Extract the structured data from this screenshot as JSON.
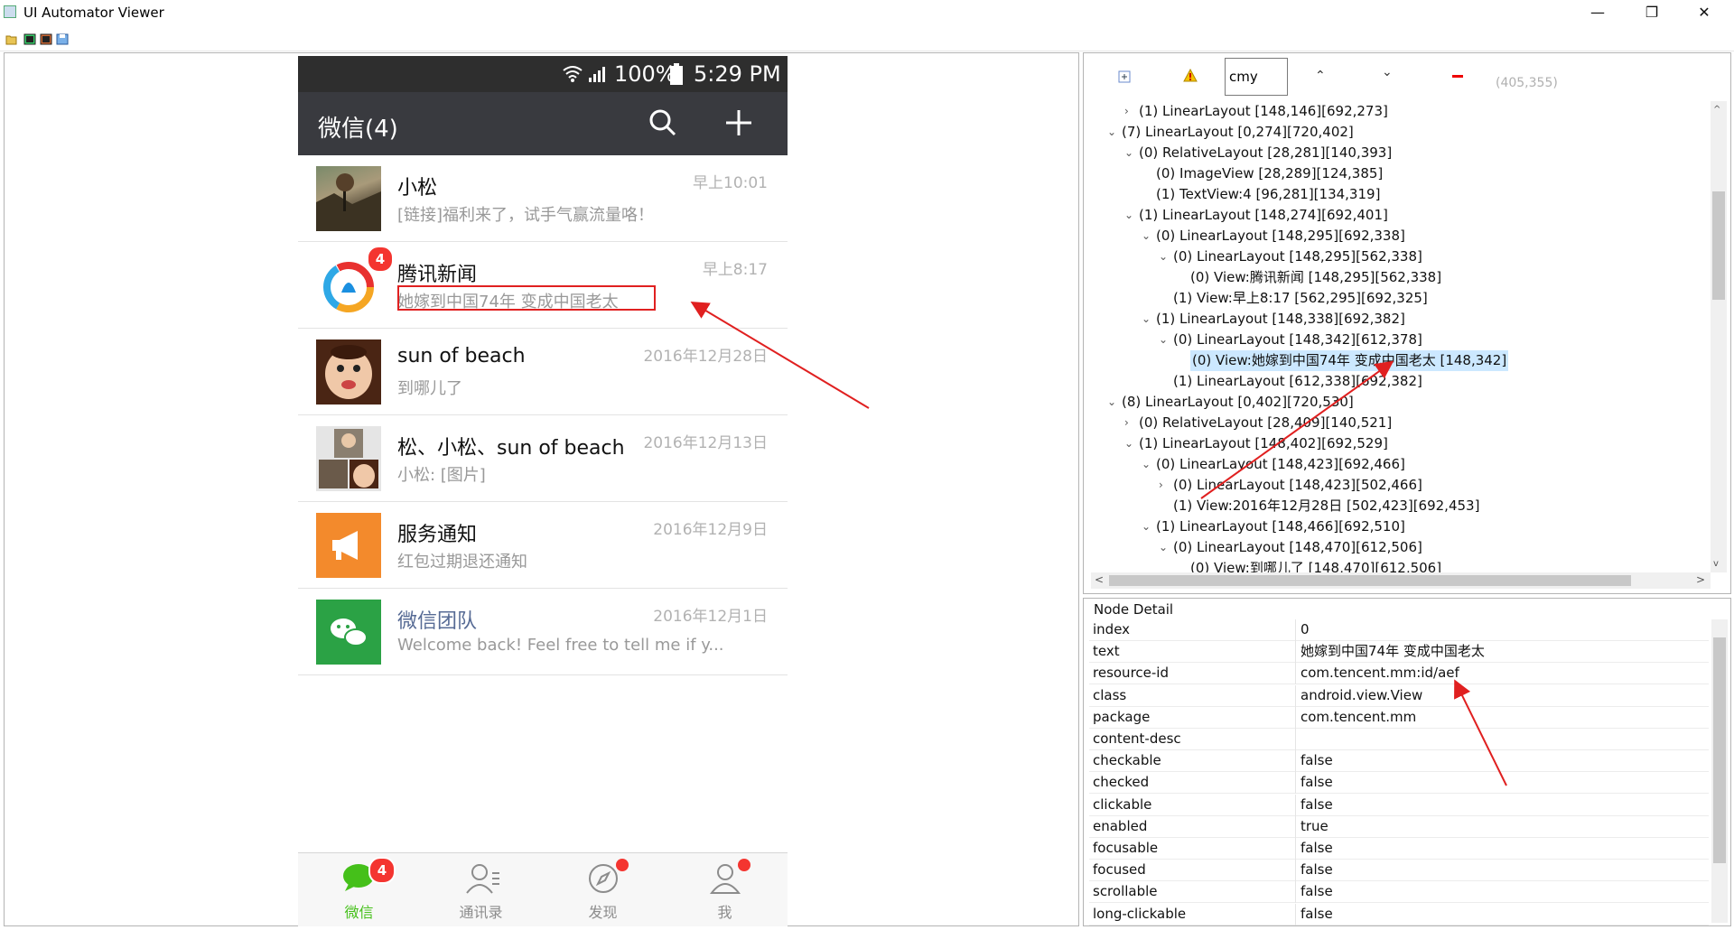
{
  "window": {
    "title": "UI Automator Viewer",
    "minimize_glyph": "—",
    "restore_glyph": "❐",
    "close_glyph": "✕"
  },
  "toolbar": {
    "icons": [
      "open-folder-icon",
      "device-screenshot-icon",
      "device-screenshot-compressed-icon",
      "save-icon"
    ]
  },
  "phone": {
    "status": {
      "battery_pct": "100%",
      "clock": "5:29 PM"
    },
    "appbar": {
      "title": "微信(4)"
    },
    "chats": [
      {
        "name": "小松",
        "time": "早上10:01",
        "message": "[链接]福利来了，试手气赢流量咯！",
        "avatar": "photo-avatar",
        "badge": ""
      },
      {
        "name": "腾讯新闻",
        "time": "早上8:17",
        "message": "她嫁到中国74年 变成中国老太",
        "avatar": "tencent-news-avatar",
        "badge": "4"
      },
      {
        "name": "sun of beach",
        "time": "2016年12月28日",
        "message": "到哪儿了",
        "avatar": "cartoon-avatar",
        "badge": ""
      },
      {
        "name": "松、小松、sun of beach",
        "time": "2016年12月13日",
        "message": "小松: [图片]",
        "avatar": "group-avatar",
        "badge": ""
      },
      {
        "name": "服务通知",
        "time": "2016年12月9日",
        "message": "红包过期退还通知",
        "avatar": "service-notice-avatar",
        "badge": ""
      },
      {
        "name": "微信团队",
        "time": "2016年12月1日",
        "message": "Welcome back! Feel free to tell me if y...",
        "avatar": "wechat-team-avatar",
        "badge": ""
      }
    ],
    "tabs": [
      {
        "label": "微信",
        "badge": "4",
        "active": true
      },
      {
        "label": "通讯录",
        "badge": "",
        "active": false
      },
      {
        "label": "发现",
        "badge": "dot",
        "active": false
      },
      {
        "label": "我",
        "badge": "dot",
        "active": false
      }
    ],
    "colors": {
      "statusbar": "#2e2e2e",
      "appbar": "#393a3f",
      "accent_green": "#45c01a",
      "badge_red": "#f43530",
      "team_blue": "#576b95"
    }
  },
  "tree": {
    "search_value": "cmy",
    "coords": "(405,355)",
    "nodes": [
      {
        "depth": 1,
        "toggle": ">",
        "text": "(1) LinearLayout [148,146][692,273]"
      },
      {
        "depth": 0,
        "toggle": "v",
        "text": "(7) LinearLayout [0,274][720,402]"
      },
      {
        "depth": 1,
        "toggle": "v",
        "text": "(0) RelativeLayout [28,281][140,393]"
      },
      {
        "depth": 2,
        "toggle": "",
        "text": "(0) ImageView [28,289][124,385]"
      },
      {
        "depth": 2,
        "toggle": "",
        "text": "(1) TextView:4 [96,281][134,319]"
      },
      {
        "depth": 1,
        "toggle": "v",
        "text": "(1) LinearLayout [148,274][692,401]"
      },
      {
        "depth": 2,
        "toggle": "v",
        "text": "(0) LinearLayout [148,295][692,338]"
      },
      {
        "depth": 3,
        "toggle": "v",
        "text": "(0) LinearLayout [148,295][562,338]"
      },
      {
        "depth": 4,
        "toggle": "",
        "text": "(0) View:腾讯新闻 [148,295][562,338]"
      },
      {
        "depth": 3,
        "toggle": "",
        "text": "(1) View:早上8:17 [562,295][692,325]"
      },
      {
        "depth": 2,
        "toggle": "v",
        "text": "(1) LinearLayout [148,338][692,382]"
      },
      {
        "depth": 3,
        "toggle": "v",
        "text": "(0) LinearLayout [148,342][612,378]"
      },
      {
        "depth": 4,
        "toggle": "",
        "text": "(0) View:她嫁到中国74年 变成中国老太 [148,342]",
        "selected": true
      },
      {
        "depth": 3,
        "toggle": "",
        "text": "(1) LinearLayout [612,338][692,382]"
      },
      {
        "depth": 0,
        "toggle": "v",
        "text": "(8) LinearLayout [0,402][720,530]"
      },
      {
        "depth": 1,
        "toggle": ">",
        "text": "(0) RelativeLayout [28,409][140,521]"
      },
      {
        "depth": 1,
        "toggle": "v",
        "text": "(1) LinearLayout [148,402][692,529]"
      },
      {
        "depth": 2,
        "toggle": "v",
        "text": "(0) LinearLayout [148,423][692,466]"
      },
      {
        "depth": 3,
        "toggle": ">",
        "text": "(0) LinearLayout [148,423][502,466]"
      },
      {
        "depth": 3,
        "toggle": "",
        "text": "(1) View:2016年12月28日 [502,423][692,453]"
      },
      {
        "depth": 2,
        "toggle": "v",
        "text": "(1) LinearLayout [148,466][692,510]"
      },
      {
        "depth": 3,
        "toggle": "v",
        "text": "(0) LinearLayout [148,470][612,506]"
      },
      {
        "depth": 4,
        "toggle": "",
        "text": "(0) View:到哪儿了 [148,470][612,506]"
      }
    ]
  },
  "detail": {
    "title": "Node Detail",
    "rows": [
      {
        "key": "index",
        "value": "0"
      },
      {
        "key": "text",
        "value": "她嫁到中国74年 变成中国老太"
      },
      {
        "key": "resource-id",
        "value": "com.tencent.mm:id/aef"
      },
      {
        "key": "class",
        "value": "android.view.View"
      },
      {
        "key": "package",
        "value": "com.tencent.mm"
      },
      {
        "key": "content-desc",
        "value": ""
      },
      {
        "key": "checkable",
        "value": "false"
      },
      {
        "key": "checked",
        "value": "false"
      },
      {
        "key": "clickable",
        "value": "false"
      },
      {
        "key": "enabled",
        "value": "true"
      },
      {
        "key": "focusable",
        "value": "false"
      },
      {
        "key": "focused",
        "value": "false"
      },
      {
        "key": "scrollable",
        "value": "false"
      },
      {
        "key": "long-clickable",
        "value": "false"
      }
    ]
  }
}
